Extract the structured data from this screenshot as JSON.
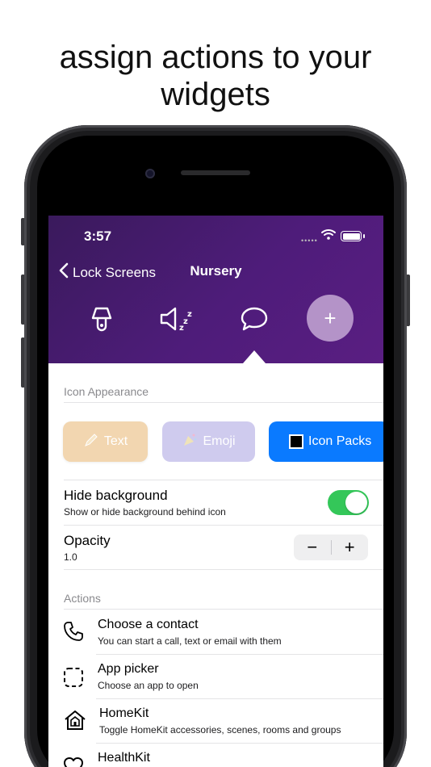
{
  "headline": {
    "line1": "assign actions to your",
    "line2": "widgets"
  },
  "status": {
    "time": "3:57",
    "signal": "•••••"
  },
  "nav": {
    "back_label": "Lock Screens",
    "title": "Nursery"
  },
  "hero_icons": [
    "lamp-icon",
    "speaker-mute-icon",
    "chat-bubble-icon"
  ],
  "add_label": "+",
  "appearance": {
    "section_label": "Icon Appearance",
    "chips": {
      "text": "Text",
      "emoji": "Emoji",
      "icon_packs": "Icon Packs"
    }
  },
  "hide_background": {
    "title": "Hide background",
    "subtitle": "Show or hide background behind icon",
    "enabled": true
  },
  "opacity": {
    "title": "Opacity",
    "value": "1.0",
    "minus": "−",
    "plus": "+"
  },
  "actions": {
    "section_label": "Actions",
    "items": [
      {
        "title": "Choose a contact",
        "subtitle": "You can start a call, text or email with them",
        "icon": "phone-icon"
      },
      {
        "title": "App picker",
        "subtitle": "Choose an app to open",
        "icon": "dashed-square-icon"
      },
      {
        "title": "HomeKit",
        "subtitle": "Toggle HomeKit accessories, scenes, rooms and groups",
        "icon": "home-icon"
      },
      {
        "title": "HealthKit",
        "subtitle": "",
        "icon": "heart-icon"
      }
    ]
  },
  "colors": {
    "accent": "#0a7aff",
    "toggle_on": "#34c759",
    "hero": "#4e1c7a"
  }
}
